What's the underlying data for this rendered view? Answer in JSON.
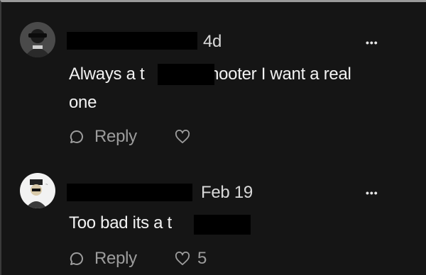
{
  "comments": [
    {
      "time": "4d",
      "text_before": "Always a t",
      "text_after": "shooter I want a real",
      "text_line2": "one",
      "reply_label": "Reply",
      "like_count": "",
      "more_icon": "more-horizontal-icon"
    },
    {
      "time": "Feb 19",
      "text_before": "Too bad its a t",
      "reply_label": "Reply",
      "like_count": "5",
      "more_icon": "more-horizontal-icon"
    }
  ],
  "more_label": "•••",
  "colors": {
    "background": "#151515",
    "text": "#f2f2f2",
    "muted": "#9c9c9c",
    "redaction": "#000000"
  }
}
